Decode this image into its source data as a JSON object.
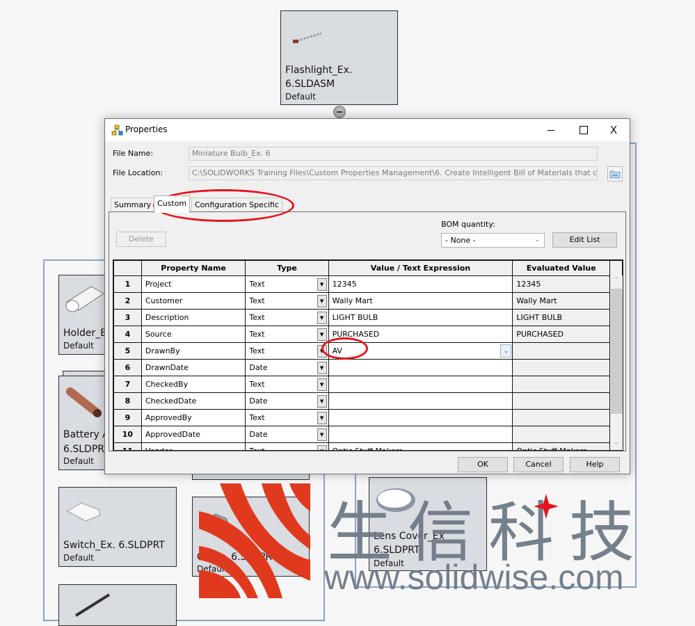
{
  "background": {
    "root_node": {
      "name_line1": "Flashlight_Ex.",
      "name_line2": "6.SLDASM",
      "config": "Default"
    },
    "nodes": [
      {
        "name_line1": "Holder_E",
        "name_line2": "",
        "config": "Default"
      },
      {
        "name_line1": "Battery A",
        "name_line2": "6.SLDPRT",
        "config": "Default"
      },
      {
        "name_line1": "Switch_Ex. 6.SLDPRT",
        "name_line2": "",
        "config": "Default"
      },
      {
        "name_line1": "C...Ex. 6.SLDPRT",
        "name_line2": "",
        "config": "Default"
      },
      {
        "name_line1": "Lens Cover_Ex",
        "name_line2": "6.SLDPRT",
        "config": "Default"
      }
    ]
  },
  "dialog": {
    "title": "Properties",
    "window_controls": {
      "minimize": "",
      "maximize": "",
      "close": "X"
    },
    "file_name_label": "File Name:",
    "file_name_value": "Miniature Bulb_Ex. 6",
    "file_location_label": "File Location:",
    "file_location_value": "C:\\SOLIDWORKS Training Files\\Custom Properties Management\\6. Create Intelligent Bill of Materials that can M",
    "tabs": [
      {
        "label": "Summary",
        "active": false
      },
      {
        "label": "Custom",
        "active": true
      },
      {
        "label": "Configuration Specific",
        "active": false
      }
    ],
    "delete_label": "Delete",
    "bom_quantity_label": "BOM quantity:",
    "bom_quantity_value": "- None -",
    "edit_list_label": "Edit List",
    "grid": {
      "headers": [
        "",
        "Property Name",
        "Type",
        "Value / Text Expression",
        "Evaluated Value"
      ],
      "rows": [
        {
          "num": "1",
          "name": "Project",
          "type": "Text",
          "value": "12345",
          "evaluated": "12345"
        },
        {
          "num": "2",
          "name": "Customer",
          "type": "Text",
          "value": "Wally Mart",
          "evaluated": "Wally Mart"
        },
        {
          "num": "3",
          "name": "Description",
          "type": "Text",
          "value": "LIGHT BULB",
          "evaluated": "LIGHT BULB"
        },
        {
          "num": "4",
          "name": "Source",
          "type": "Text",
          "value": "PURCHASED",
          "evaluated": "PURCHASED"
        },
        {
          "num": "5",
          "name": "DrawnBy",
          "type": "Text",
          "value": "AV",
          "evaluated": ""
        },
        {
          "num": "6",
          "name": "DrawnDate",
          "type": "Date",
          "value": "",
          "evaluated": ""
        },
        {
          "num": "7",
          "name": "CheckedBy",
          "type": "Text",
          "value": "",
          "evaluated": ""
        },
        {
          "num": "8",
          "name": "CheckedDate",
          "type": "Date",
          "value": "",
          "evaluated": ""
        },
        {
          "num": "9",
          "name": "ApprovedBy",
          "type": "Text",
          "value": "",
          "evaluated": ""
        },
        {
          "num": "10",
          "name": "ApprovedDate",
          "type": "Date",
          "value": "",
          "evaluated": ""
        },
        {
          "num": "11",
          "name": "Vendor",
          "type": "Text",
          "value": "Optic Stuff Makers",
          "evaluated": "Optic Stuff Makers"
        }
      ]
    },
    "ok_label": "OK",
    "cancel_label": "Cancel",
    "help_label": "Help"
  },
  "watermark": {
    "chinese": "生信科技",
    "url": "www.solidwise.com"
  },
  "colors": {
    "annotation_red": "#e4141e",
    "node_fill": "#d9dce1",
    "group_frame": "#8aa4c4",
    "watermark_gray": "#6f7a88",
    "logo_red": "#e03a1e"
  }
}
